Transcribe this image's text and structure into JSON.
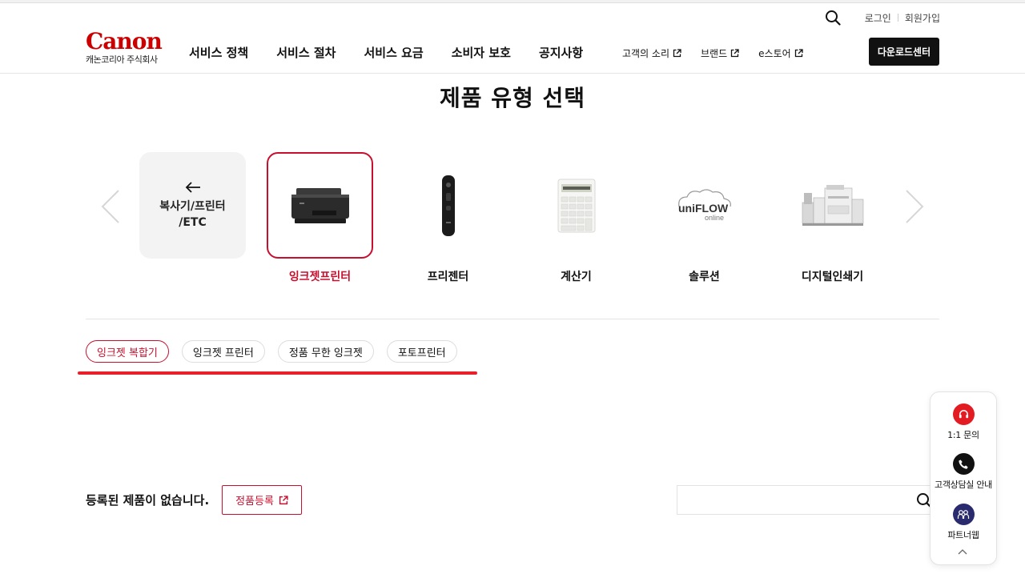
{
  "header": {
    "logo_text": "Canon",
    "logo_sub": "캐논코리아 주식회사",
    "util": {
      "login": "로그인",
      "signup": "회원가입"
    },
    "nav": [
      "서비스 정책",
      "서비스 절차",
      "서비스 요금",
      "소비자 보호",
      "공지사항"
    ],
    "ext_links": [
      "고객의 소리",
      "브랜드",
      "e스토어"
    ],
    "download_button": "다운로드센터"
  },
  "page": {
    "title": "제품 유형 선택",
    "back_card_label_1": "복사기/프린터",
    "back_card_label_2": "/ETC",
    "products": [
      {
        "name": "잉크젯프린터",
        "selected": true,
        "icon": "inkjet-printer-image"
      },
      {
        "name": "프리젠터",
        "selected": false,
        "icon": "presenter-image"
      },
      {
        "name": "계산기",
        "selected": false,
        "icon": "calculator-image"
      },
      {
        "name": "솔루션",
        "selected": false,
        "icon": "uniflow-logo"
      },
      {
        "name": "디지털인쇄기",
        "selected": false,
        "icon": "digital-press-image"
      }
    ],
    "uniflow_logo_main": "uniFLOW",
    "uniflow_logo_sub": "online",
    "subcategories": [
      {
        "label": "잉크젯 복합기",
        "active": true
      },
      {
        "label": "잉크젯 프린터",
        "active": false
      },
      {
        "label": "정품 무한 잉크젯",
        "active": false
      },
      {
        "label": "포토프린터",
        "active": false
      }
    ],
    "empty_message": "등록된 제품이 없습니다.",
    "register_button": "정품등록",
    "search": {
      "value": "",
      "placeholder": ""
    }
  },
  "floating": {
    "items": [
      {
        "label": "1:1 문의",
        "icon": "headset-icon"
      },
      {
        "label": "고객상담실 안내",
        "icon": "phone-icon"
      },
      {
        "label": "파트너웹",
        "icon": "partner-icon"
      }
    ]
  },
  "colors": {
    "brand": "#cc0000",
    "accent": "#c8102e",
    "highlight": "#e8202a",
    "dark": "#111111",
    "partner": "#2a2a6e"
  }
}
